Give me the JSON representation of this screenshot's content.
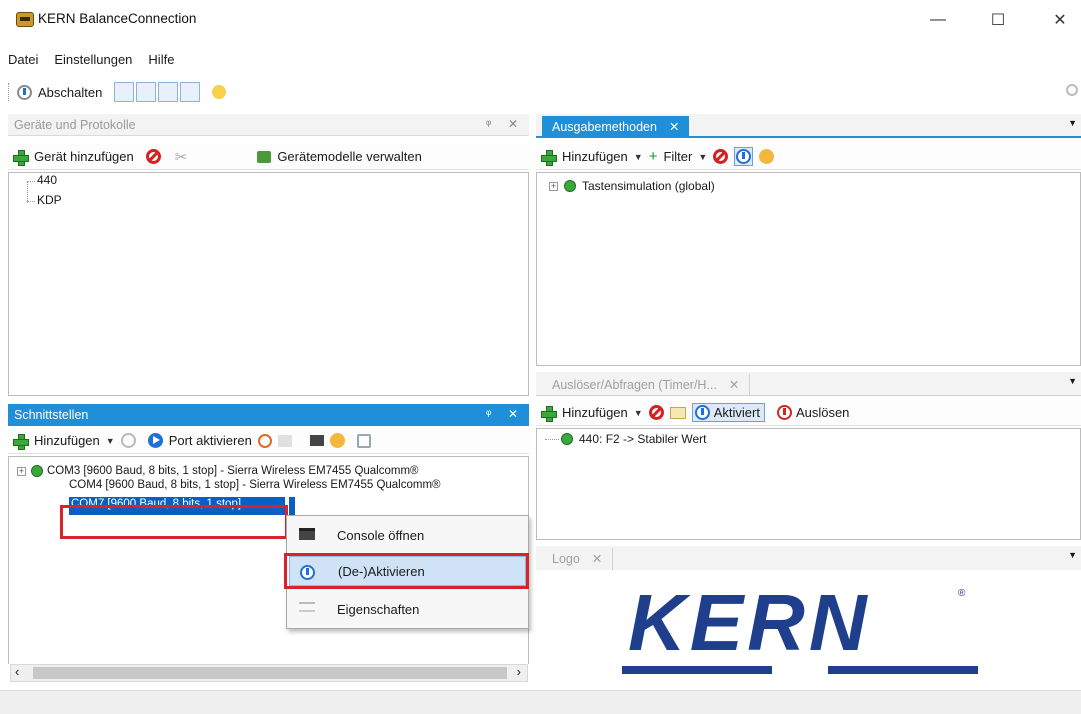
{
  "window": {
    "title": "KERN BalanceConnection",
    "minimize": "—",
    "maximize": "☐",
    "close": "✕"
  },
  "menu": [
    "Datei",
    "Einstellungen",
    "Hilfe"
  ],
  "toolbar": {
    "shutdown_label": "Abschalten"
  },
  "devices_panel": {
    "title": "Geräte und Protokolle",
    "pin": "ᵠ",
    "close": "✕",
    "add_device": "Gerät hinzufügen",
    "manage_models": "Gerätemodelle verwalten",
    "items": [
      "440",
      "KDP"
    ]
  },
  "output_panel": {
    "tab": "Ausgabemethoden",
    "tab_close": "✕",
    "add": "Hinzufügen",
    "filter": "Filter",
    "items": [
      "Tastensimulation (global)"
    ]
  },
  "triggers_panel": {
    "tab": "Auslöser/Abfragen (Timer/H...",
    "tab_close": "✕",
    "add": "Hinzufügen",
    "activated": "Aktiviert",
    "trigger": "Auslösen",
    "items": [
      "440: F2 -> Stabiler Wert"
    ]
  },
  "interfaces_panel": {
    "title": "Schnittstellen",
    "pin": "ᵠ",
    "close": "✕",
    "add": "Hinzufügen",
    "activate_port": "Port aktivieren",
    "items": [
      "COM3 [9600 Baud, 8 bits, 1 stop] - Sierra Wireless EM7455 Qualcomm®",
      "COM4 [9600 Baud, 8 bits, 1 stop] - Sierra Wireless EM7455 Qualcomm®",
      "COM7 [9600 Baud, 8 bits, 1 stop]"
    ],
    "scroll_left": "‹",
    "scroll_right": "›"
  },
  "context_menu": {
    "items": [
      "Console öffnen",
      "(De-)Aktivieren",
      "Eigenschaften"
    ]
  },
  "logo_panel": {
    "tab": "Logo",
    "tab_close": "✕",
    "logo_text": "KERN",
    "registered": "®"
  },
  "colors": {
    "accent": "#1e8fd8",
    "highlight": "#0a5fc0",
    "logo_blue": "#1f3f8c",
    "red_frame": "#d8232a"
  }
}
